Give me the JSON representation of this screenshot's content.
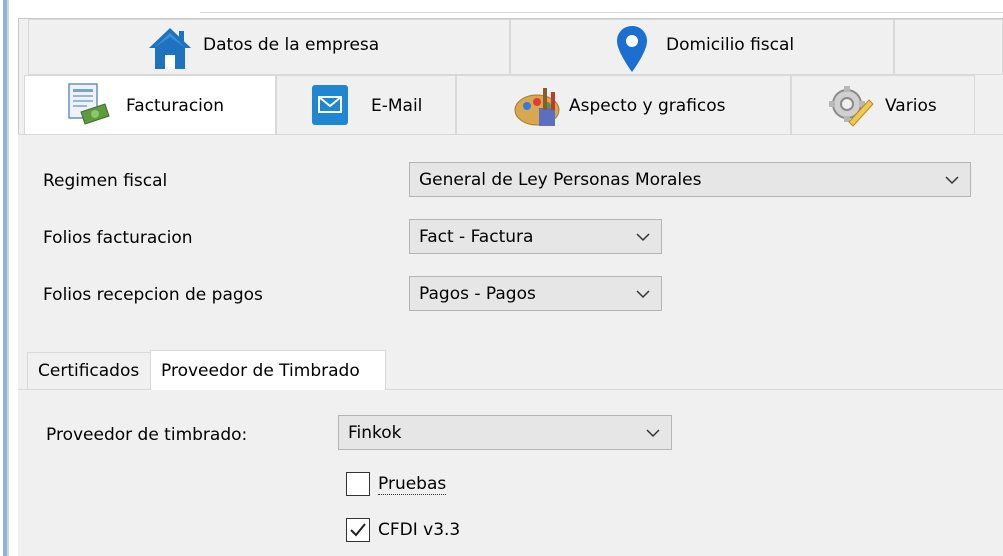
{
  "top_tabs": [
    {
      "label": "Datos de la empresa",
      "icon": "home-icon"
    },
    {
      "label": "Domicilio fiscal",
      "icon": "location-pin-icon"
    }
  ],
  "sub_tabs": [
    {
      "label": "Facturacion",
      "icon": "invoice-icon",
      "active": true
    },
    {
      "label": "E-Mail",
      "icon": "mail-icon"
    },
    {
      "label": "Aspecto y graficos",
      "icon": "paint-palette-icon"
    },
    {
      "label": "Varios",
      "icon": "gear-icon"
    }
  ],
  "form": {
    "regimen_fiscal_label": "Regimen fiscal",
    "regimen_fiscal_value": "General de Ley Personas Morales",
    "folios_facturacion_label": "Folios facturacion",
    "folios_facturacion_value": "Fact - Factura",
    "folios_pagos_label": "Folios recepcion de pagos",
    "folios_pagos_value": "Pagos - Pagos"
  },
  "inner_tabs": [
    {
      "label": "Certificados"
    },
    {
      "label": "Proveedor de Timbrado",
      "active": true
    }
  ],
  "timbrado": {
    "proveedor_label": "Proveedor de timbrado:",
    "proveedor_value": "Finkok",
    "pruebas_label": "Pruebas",
    "pruebas_checked": false,
    "cfdi_label": "CFDI v3.3",
    "cfdi_checked": true
  },
  "colors": {
    "home_blue": "#1e73be",
    "pin_blue": "#1a6fd1",
    "mail_blue": "#1f86d1",
    "accent_stripe": "#8fb2d9"
  }
}
